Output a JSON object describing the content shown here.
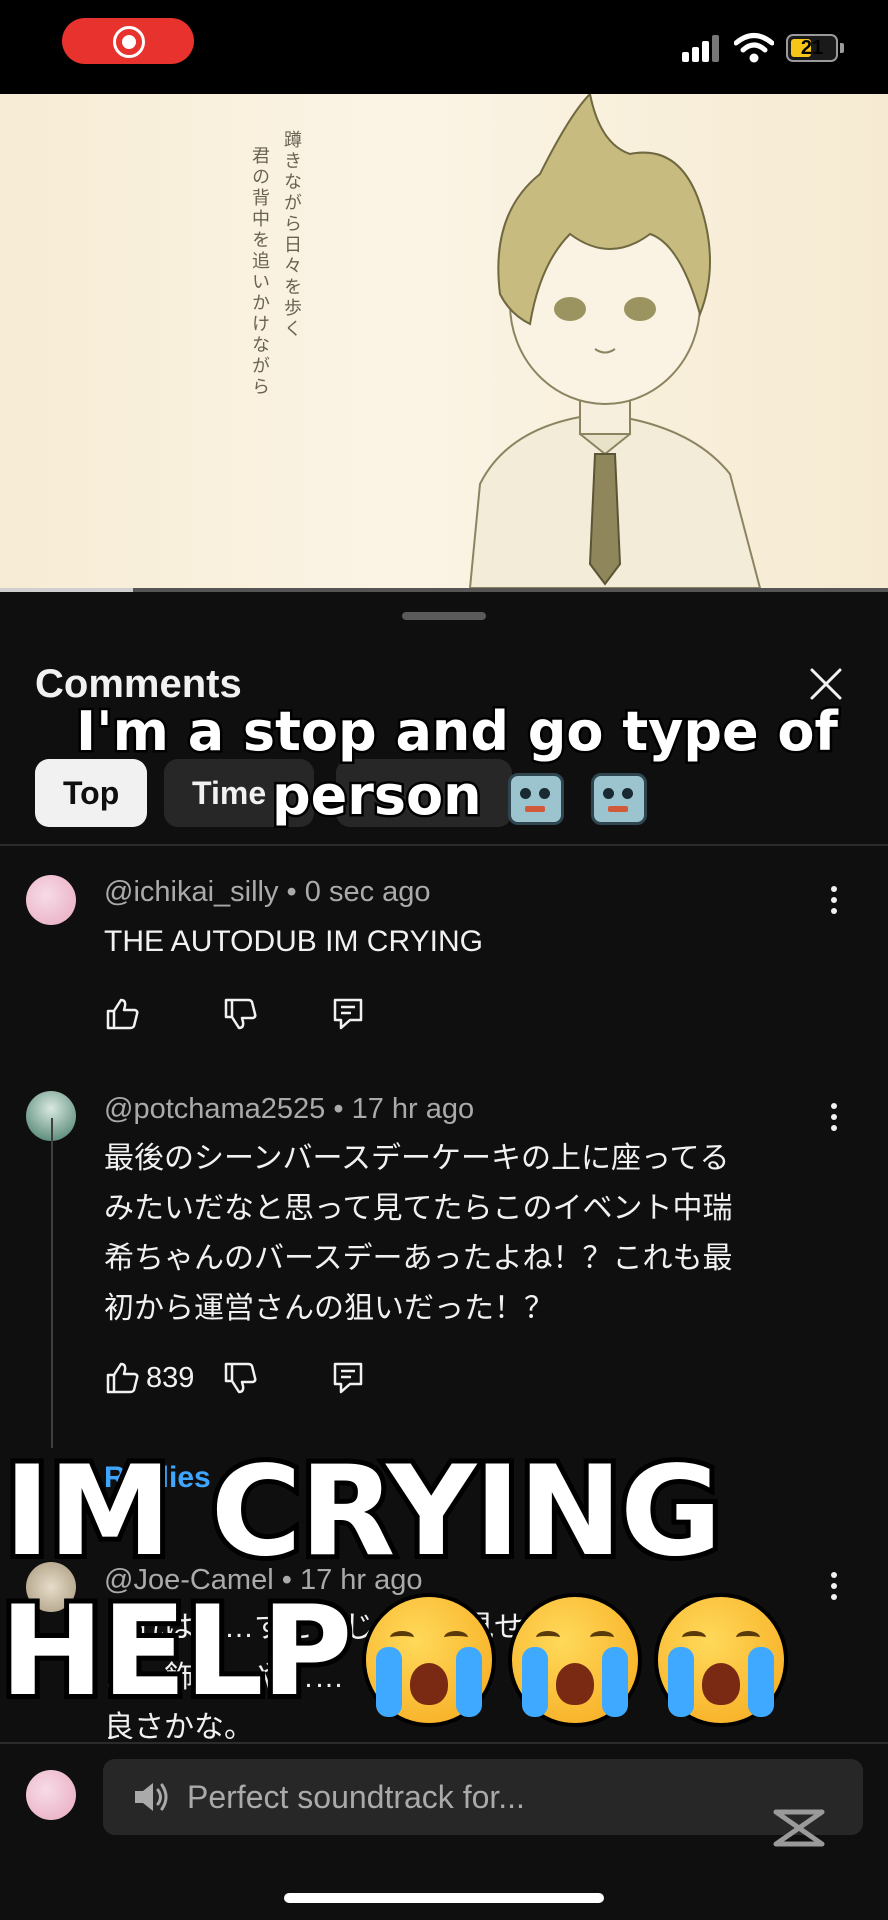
{
  "status_bar": {
    "battery": "21"
  },
  "video": {
    "lyrics": [
      "蹲きながら日々を歩く",
      "君の背中を追いかけながら"
    ]
  },
  "comments_sheet": {
    "title": "Comments",
    "tabs": [
      {
        "label": "Top",
        "selected": true
      },
      {
        "label": "Time",
        "selected": false
      }
    ]
  },
  "comments": [
    {
      "author": "@ichikai_silly",
      "time": "0 sec ago",
      "text": "THE AUTODUB IM CRYING",
      "likes": ""
    },
    {
      "author": "@potchama2525",
      "time": "17 hr ago",
      "text": "最後のシーンバースデーケーキの上に座ってる\nみたいだなと思って見てたらこのイベント中瑞\n希ちゃんのバースデーあったよね！？これも最\n初から運営さんの狙いだった！？",
      "likes": "839"
    }
  ],
  "replies": {
    "label": "Replies",
    "reply": {
      "author": "@Joe-Camel",
      "time": "17 hr ago",
      "text": "これは……すごいじゃ……見せ\n……飾……や……\n良さかな。"
    }
  },
  "composer": {
    "placeholder": "Perfect soundtrack for..."
  },
  "overlay": {
    "caption_line1": "I'm a stop and go type of",
    "caption_line2": "person",
    "big_line1": "IM CRYING",
    "big_line2": "HELP"
  },
  "colors": {
    "record": "#e8322d",
    "background": "#0f0f0f",
    "battery": "#f5c518"
  }
}
